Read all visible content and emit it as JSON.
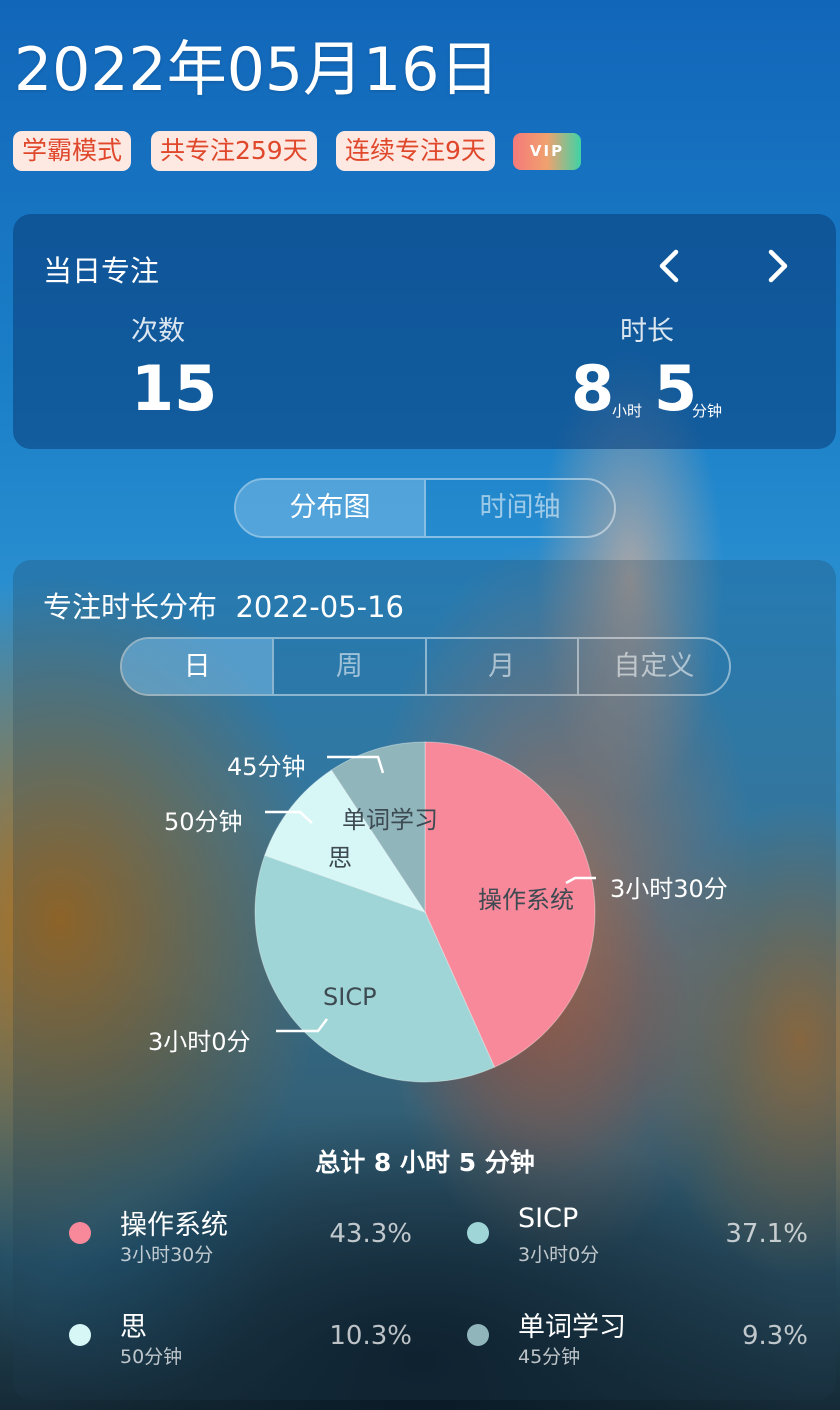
{
  "header": {
    "date": "2022年05月16日",
    "tags": [
      "学霸模式",
      "共专注259天",
      "连续专注9天"
    ],
    "vip": "VIP"
  },
  "daily_focus": {
    "title": "当日专注",
    "count_label": "次数",
    "count_value": "15",
    "duration_label": "时长",
    "hours": "8",
    "hours_unit": "小时",
    "minutes": "5",
    "minutes_unit": "分钟"
  },
  "view_tabs": [
    "分布图",
    "时间轴"
  ],
  "distribution": {
    "title": "专注时长分布",
    "date": "2022-05-16",
    "range_tabs": [
      "日",
      "周",
      "月",
      "自定义"
    ],
    "total": "总计 8 小时 5 分钟"
  },
  "chart_data": {
    "type": "pie",
    "slices": [
      {
        "name": "操作系统",
        "minutes": 210,
        "duration_label": "3小时30分",
        "percent": "43.3%",
        "color": "#f7899a"
      },
      {
        "name": "SICP",
        "minutes": 180,
        "duration_label": "3小时0分",
        "percent": "37.1%",
        "color": "#9fd5d6"
      },
      {
        "name": "思",
        "minutes": 50,
        "duration_label": "50分钟",
        "percent": "10.3%",
        "color": "#d7f7f6"
      },
      {
        "name": "单词学习",
        "minutes": 45,
        "duration_label": "45分钟",
        "percent": "9.3%",
        "color": "#90b6bc"
      }
    ]
  }
}
